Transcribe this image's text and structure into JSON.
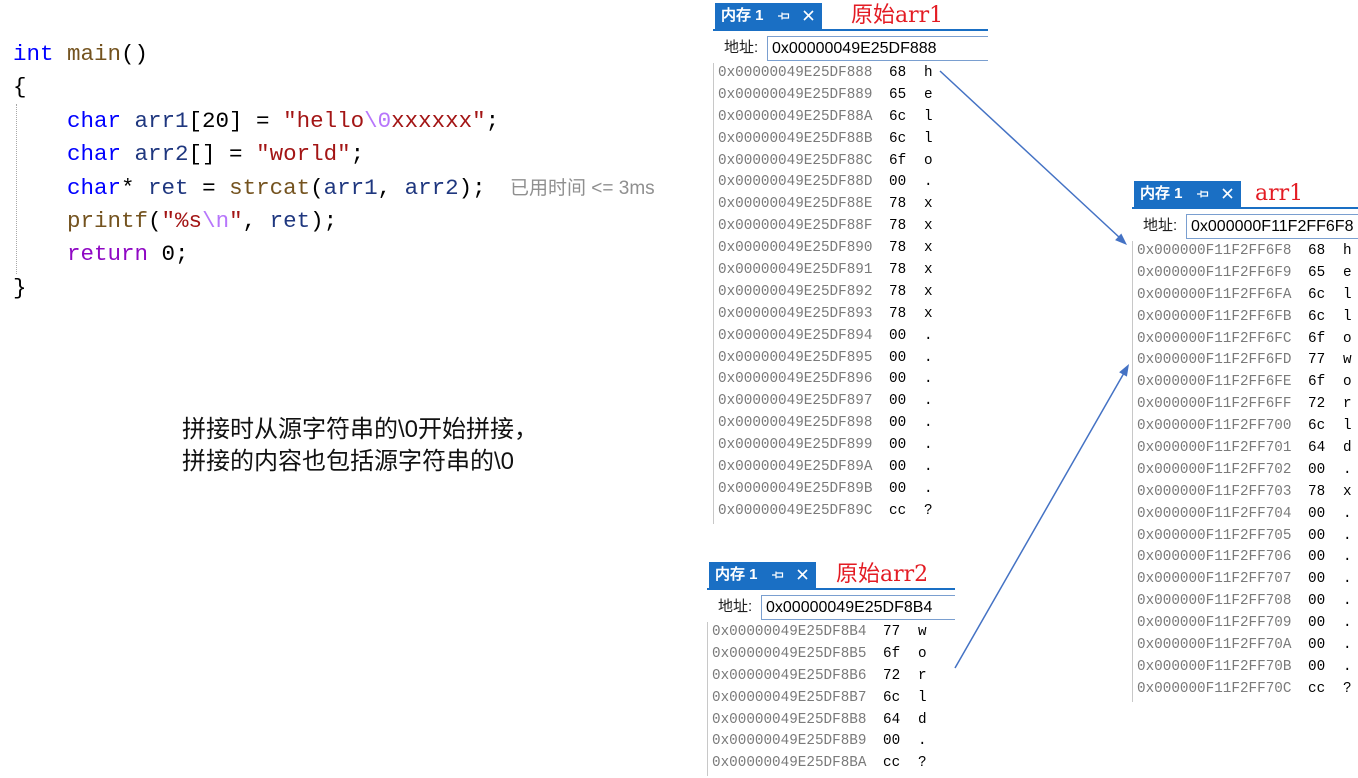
{
  "editor": {
    "lines": [
      {
        "tokens": [
          {
            "text": "int",
            "color": "#0000ff"
          },
          {
            "text": " main",
            "color": "#74531f"
          },
          {
            "text": "()",
            "color": "#000000"
          }
        ]
      },
      {
        "tokens": [
          {
            "text": "{",
            "color": "#000000"
          }
        ]
      },
      {
        "tokens": [
          {
            "text": "    char",
            "color": "#0000ff"
          },
          {
            "text": " arr1",
            "color": "#1f377f"
          },
          {
            "text": "[20] = ",
            "color": "#000000"
          },
          {
            "text": "\"hello",
            "color": "#a31515"
          },
          {
            "text": "\\0",
            "color": "#b776fb"
          },
          {
            "text": "xxxxxx\"",
            "color": "#a31515"
          },
          {
            "text": ";",
            "color": "#000000"
          }
        ]
      },
      {
        "tokens": [
          {
            "text": "    char",
            "color": "#0000ff"
          },
          {
            "text": " arr2",
            "color": "#1f377f"
          },
          {
            "text": "[] = ",
            "color": "#000000"
          },
          {
            "text": "\"world\"",
            "color": "#a31515"
          },
          {
            "text": ";",
            "color": "#000000"
          }
        ]
      },
      {
        "tokens": [
          {
            "text": "    char",
            "color": "#0000ff"
          },
          {
            "text": "*",
            "color": "#000000"
          },
          {
            "text": " ret",
            "color": "#1f377f"
          },
          {
            "text": " = ",
            "color": "#000000"
          },
          {
            "text": "strcat",
            "color": "#74531f"
          },
          {
            "text": "(",
            "color": "#000000"
          },
          {
            "text": "arr1",
            "color": "#1f377f"
          },
          {
            "text": ", ",
            "color": "#000000"
          },
          {
            "text": "arr2",
            "color": "#1f377f"
          },
          {
            "text": ");",
            "color": "#000000"
          }
        ]
      },
      {
        "tokens": [
          {
            "text": "    printf",
            "color": "#74531f"
          },
          {
            "text": "(",
            "color": "#000000"
          },
          {
            "text": "\"%s",
            "color": "#a31515"
          },
          {
            "text": "\\n",
            "color": "#b776fb"
          },
          {
            "text": "\"",
            "color": "#a31515"
          },
          {
            "text": ", ",
            "color": "#000000"
          },
          {
            "text": "ret",
            "color": "#1f377f"
          },
          {
            "text": ");",
            "color": "#000000"
          }
        ]
      },
      {
        "tokens": [
          {
            "text": "    return",
            "color": "#8f08c4"
          },
          {
            "text": " 0;",
            "color": "#000000"
          }
        ]
      },
      {
        "tokens": [
          {
            "text": "}",
            "color": "#000000"
          }
        ]
      }
    ],
    "perf_tip": "已用时间 <= 3ms"
  },
  "annotation": {
    "lines": [
      "拼接时从源字符串的\\0开始拼接，",
      "拼接的内容也包括源字符串的\\0"
    ]
  },
  "icons": {
    "pin": "pin-icon",
    "close": "close-icon"
  },
  "colors": {
    "tab_blue": "#1a6fc4",
    "caption_red": "#e31b23",
    "arrow_blue": "#4472c4",
    "address_gray": "#7a7a7a"
  },
  "memory_windows": [
    {
      "tab_label": "内存 1",
      "caption": "原始arr1",
      "address_label": "地址:",
      "address": "0x00000049E25DF888",
      "rows": [
        {
          "addr": "0x00000049E25DF888",
          "hex": "68",
          "ascii": "h"
        },
        {
          "addr": "0x00000049E25DF889",
          "hex": "65",
          "ascii": "e"
        },
        {
          "addr": "0x00000049E25DF88A",
          "hex": "6c",
          "ascii": "l"
        },
        {
          "addr": "0x00000049E25DF88B",
          "hex": "6c",
          "ascii": "l"
        },
        {
          "addr": "0x00000049E25DF88C",
          "hex": "6f",
          "ascii": "o"
        },
        {
          "addr": "0x00000049E25DF88D",
          "hex": "00",
          "ascii": "."
        },
        {
          "addr": "0x00000049E25DF88E",
          "hex": "78",
          "ascii": "x"
        },
        {
          "addr": "0x00000049E25DF88F",
          "hex": "78",
          "ascii": "x"
        },
        {
          "addr": "0x00000049E25DF890",
          "hex": "78",
          "ascii": "x"
        },
        {
          "addr": "0x00000049E25DF891",
          "hex": "78",
          "ascii": "x"
        },
        {
          "addr": "0x00000049E25DF892",
          "hex": "78",
          "ascii": "x"
        },
        {
          "addr": "0x00000049E25DF893",
          "hex": "78",
          "ascii": "x"
        },
        {
          "addr": "0x00000049E25DF894",
          "hex": "00",
          "ascii": "."
        },
        {
          "addr": "0x00000049E25DF895",
          "hex": "00",
          "ascii": "."
        },
        {
          "addr": "0x00000049E25DF896",
          "hex": "00",
          "ascii": "."
        },
        {
          "addr": "0x00000049E25DF897",
          "hex": "00",
          "ascii": "."
        },
        {
          "addr": "0x00000049E25DF898",
          "hex": "00",
          "ascii": "."
        },
        {
          "addr": "0x00000049E25DF899",
          "hex": "00",
          "ascii": "."
        },
        {
          "addr": "0x00000049E25DF89A",
          "hex": "00",
          "ascii": "."
        },
        {
          "addr": "0x00000049E25DF89B",
          "hex": "00",
          "ascii": "."
        },
        {
          "addr": "0x00000049E25DF89C",
          "hex": "cc",
          "ascii": "?"
        }
      ]
    },
    {
      "tab_label": "内存 1",
      "caption": "原始arr2",
      "address_label": "地址:",
      "address": "0x00000049E25DF8B4",
      "rows": [
        {
          "addr": "0x00000049E25DF8B4",
          "hex": "77",
          "ascii": "w"
        },
        {
          "addr": "0x00000049E25DF8B5",
          "hex": "6f",
          "ascii": "o"
        },
        {
          "addr": "0x00000049E25DF8B6",
          "hex": "72",
          "ascii": "r"
        },
        {
          "addr": "0x00000049E25DF8B7",
          "hex": "6c",
          "ascii": "l"
        },
        {
          "addr": "0x00000049E25DF8B8",
          "hex": "64",
          "ascii": "d"
        },
        {
          "addr": "0x00000049E25DF8B9",
          "hex": "00",
          "ascii": "."
        },
        {
          "addr": "0x00000049E25DF8BA",
          "hex": "cc",
          "ascii": "?"
        }
      ]
    },
    {
      "tab_label": "内存 1",
      "caption": "arr1",
      "address_label": "地址:",
      "address": "0x000000F11F2FF6F8",
      "rows": [
        {
          "addr": "0x000000F11F2FF6F8",
          "hex": "68",
          "ascii": "h"
        },
        {
          "addr": "0x000000F11F2FF6F9",
          "hex": "65",
          "ascii": "e"
        },
        {
          "addr": "0x000000F11F2FF6FA",
          "hex": "6c",
          "ascii": "l"
        },
        {
          "addr": "0x000000F11F2FF6FB",
          "hex": "6c",
          "ascii": "l"
        },
        {
          "addr": "0x000000F11F2FF6FC",
          "hex": "6f",
          "ascii": "o"
        },
        {
          "addr": "0x000000F11F2FF6FD",
          "hex": "77",
          "ascii": "w"
        },
        {
          "addr": "0x000000F11F2FF6FE",
          "hex": "6f",
          "ascii": "o"
        },
        {
          "addr": "0x000000F11F2FF6FF",
          "hex": "72",
          "ascii": "r"
        },
        {
          "addr": "0x000000F11F2FF700",
          "hex": "6c",
          "ascii": "l"
        },
        {
          "addr": "0x000000F11F2FF701",
          "hex": "64",
          "ascii": "d"
        },
        {
          "addr": "0x000000F11F2FF702",
          "hex": "00",
          "ascii": "."
        },
        {
          "addr": "0x000000F11F2FF703",
          "hex": "78",
          "ascii": "x"
        },
        {
          "addr": "0x000000F11F2FF704",
          "hex": "00",
          "ascii": "."
        },
        {
          "addr": "0x000000F11F2FF705",
          "hex": "00",
          "ascii": "."
        },
        {
          "addr": "0x000000F11F2FF706",
          "hex": "00",
          "ascii": "."
        },
        {
          "addr": "0x000000F11F2FF707",
          "hex": "00",
          "ascii": "."
        },
        {
          "addr": "0x000000F11F2FF708",
          "hex": "00",
          "ascii": "."
        },
        {
          "addr": "0x000000F11F2FF709",
          "hex": "00",
          "ascii": "."
        },
        {
          "addr": "0x000000F11F2FF70A",
          "hex": "00",
          "ascii": "."
        },
        {
          "addr": "0x000000F11F2FF70B",
          "hex": "00",
          "ascii": "."
        },
        {
          "addr": "0x000000F11F2FF70C",
          "hex": "cc",
          "ascii": "?"
        }
      ]
    }
  ]
}
